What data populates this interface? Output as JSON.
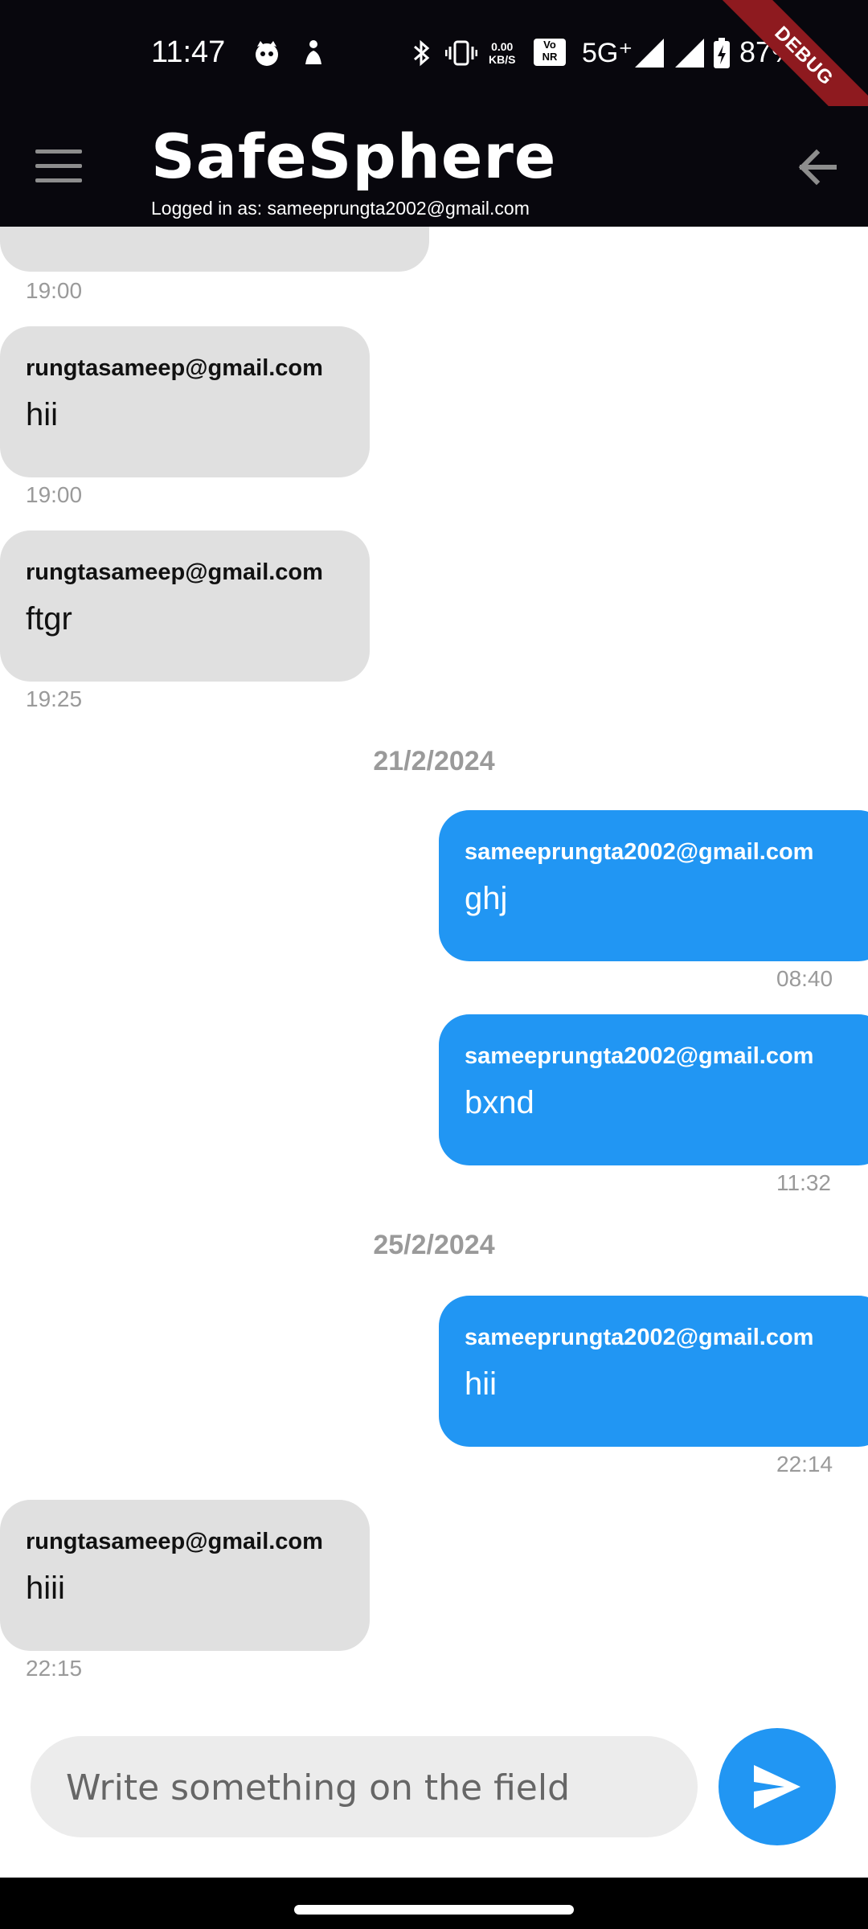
{
  "status_bar": {
    "time": "11:47",
    "net_speed_value": "0.00",
    "net_speed_unit": "KB/S",
    "vo_label": "Vo",
    "nr_label": "NR",
    "network": "5G⁺",
    "battery": "87%",
    "debug_label": "DEBUG"
  },
  "app_bar": {
    "title": "SafeSphere",
    "subtitle": "Logged in as: sameeprungta2002@gmail.com"
  },
  "messages": {
    "partial": {
      "time": "19:00"
    },
    "m1": {
      "sender": "rungtasameep@gmail.com",
      "text": "hii",
      "time": "19:00"
    },
    "m2": {
      "sender": "rungtasameep@gmail.com",
      "text": "ftgr",
      "time": "19:25"
    },
    "date1": "21/2/2024",
    "m3": {
      "sender": "sameeprungta2002@gmail.com",
      "text": "ghj",
      "time": "08:40"
    },
    "m4": {
      "sender": "sameeprungta2002@gmail.com",
      "text": "bxnd",
      "time": "11:32"
    },
    "date2": "25/2/2024",
    "m5": {
      "sender": "sameeprungta2002@gmail.com",
      "text": "hii",
      "time": "22:14"
    },
    "m6": {
      "sender": "rungtasameep@gmail.com",
      "text": "hiii",
      "time": "22:15"
    }
  },
  "composer": {
    "placeholder": "Write something on the field"
  },
  "colors": {
    "accent": "#2196f3",
    "incoming_bubble": "#e0e0e0",
    "bar_background": "#08070d",
    "debug_ribbon": "#8e1a1f"
  },
  "icons": {
    "menu": "menu-icon",
    "back": "arrow-back-icon",
    "send": "send-icon"
  }
}
